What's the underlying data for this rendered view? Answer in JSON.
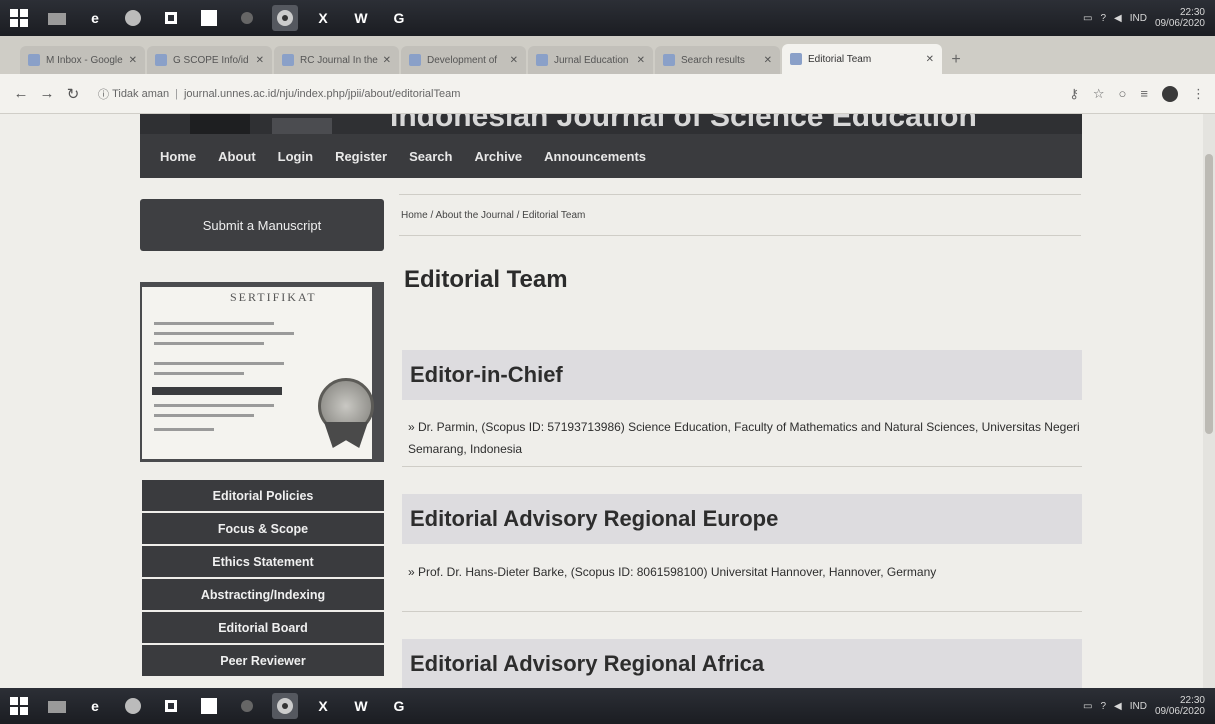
{
  "taskbar": {
    "app_labels": [
      "e",
      "X",
      "W",
      "G"
    ],
    "tray": {
      "lang": "IND",
      "time": "22:30",
      "date": "09/06/2020"
    }
  },
  "browser": {
    "tabs": [
      {
        "label": "M Inbox - Google"
      },
      {
        "label": "G SCOPE Info/id"
      },
      {
        "label": "RC Journal In the BU"
      },
      {
        "label": "Development of"
      },
      {
        "label": "Jurnal Education"
      },
      {
        "label": "Search results"
      },
      {
        "label": "Editorial Team",
        "active": true
      }
    ],
    "new_tab": "+",
    "url_security": "Tidak aman",
    "url": "journal.unnes.ac.id/nju/index.php/jpii/about/editorialTeam"
  },
  "site": {
    "header_title": "Indonesian Journal of Science Education",
    "nav": [
      "Home",
      "About",
      "Login",
      "Register",
      "Search",
      "Archive",
      "Announcements"
    ],
    "submit_label": "Submit a Manuscript",
    "cert_title": "SERTIFIKAT",
    "side_menu": [
      "Editorial Policies",
      "Focus & Scope",
      "Ethics Statement",
      "Abstracting/Indexing",
      "Editorial Board",
      "Peer Reviewer"
    ]
  },
  "content": {
    "breadcrumb": "Home / About the Journal / Editorial Team",
    "title": "Editorial Team",
    "sections": [
      {
        "heading": "Editor-in-Chief",
        "body": "» Dr. Parmin, (Scopus ID: 57193713986) Science Education, Faculty of Mathematics and Natural Sciences, Universitas Negeri Semarang, Indonesia"
      },
      {
        "heading": "Editorial Advisory Regional Europe",
        "body": "» Prof. Dr. Hans-Dieter Barke, (Scopus ID: 8061598100) Universitat Hannover, Hannover, Germany"
      },
      {
        "heading": "Editorial Advisory Regional Africa",
        "body": ""
      }
    ]
  }
}
